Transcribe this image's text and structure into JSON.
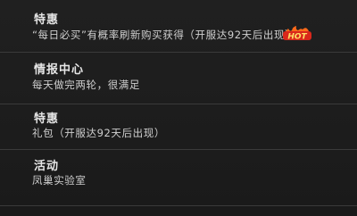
{
  "sections": [
    {
      "title": "特惠",
      "desc": "“每日必买”有概率刷新购买获得（开服达92天后出现）",
      "badge": "HOT"
    },
    {
      "title": "情报中心",
      "desc": "每天做完两轮，很满足"
    },
    {
      "title": "特惠",
      "desc": "礼包（开服达92天后出现）"
    },
    {
      "title": "活动",
      "desc": "凤巢实验室"
    }
  ],
  "colors": {
    "background": "#1c1c1c",
    "badge_red": "#d9281c",
    "badge_flame": "#ff6a1a"
  }
}
